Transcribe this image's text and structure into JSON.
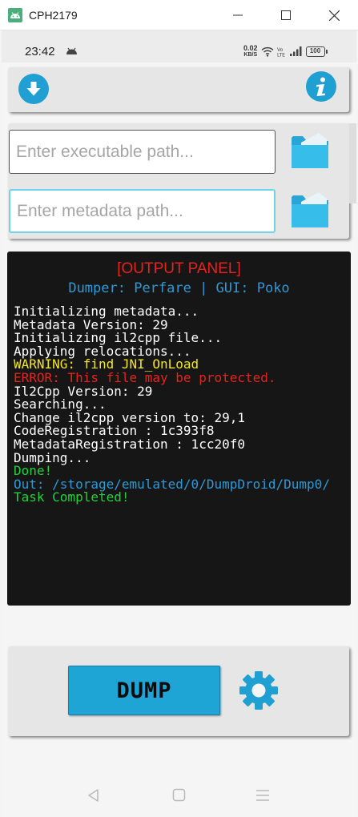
{
  "window": {
    "title": "CPH2179"
  },
  "statusbar": {
    "time": "23:42",
    "net_speed_value": "0.02",
    "net_speed_unit": "KB/S",
    "battery": "100"
  },
  "toolbar": {
    "download_icon": "download-icon",
    "info_icon": "info-icon"
  },
  "inputs": {
    "executable_placeholder": "Enter executable path...",
    "metadata_placeholder": "Enter metadata path...",
    "executable_value": "",
    "metadata_value": ""
  },
  "output": {
    "title": "[OUTPUT PANEL]",
    "subtitle": "Dumper: Perfare | GUI: Poko",
    "lines": [
      {
        "text": "Initializing metadata...",
        "color": "#ffffff"
      },
      {
        "text": "Metadata Version: 29",
        "color": "#ffffff"
      },
      {
        "text": "Initializing il2cpp file...",
        "color": "#ffffff"
      },
      {
        "text": "Applying relocations...",
        "color": "#ffffff"
      },
      {
        "text": "WARNING: find JNI_OnLoad",
        "color": "#f2e527"
      },
      {
        "text": "ERROR: This file may be protected.",
        "color": "#e8231e"
      },
      {
        "text": "Il2Cpp Version: 29",
        "color": "#ffffff"
      },
      {
        "text": "Searching...",
        "color": "#ffffff"
      },
      {
        "text": "Change il2cpp version to: 29,1",
        "color": "#ffffff"
      },
      {
        "text": "CodeRegistration : 1c393f8",
        "color": "#ffffff"
      },
      {
        "text": "MetadataRegistration : 1cc20f0",
        "color": "#ffffff"
      },
      {
        "text": "Dumping...",
        "color": "#ffffff"
      },
      {
        "text": "Done!",
        "color": "#22d23a"
      },
      {
        "text": "Out: /storage/emulated/0/DumpDroid/Dump0/",
        "color": "#2d9ad6"
      },
      {
        "text": "Task Completed!",
        "color": "#22d23a"
      }
    ]
  },
  "actions": {
    "dump_label": "DUMP",
    "settings_icon": "gear-icon"
  },
  "colors": {
    "accent": "#1fa4d6",
    "folder": "#33b9e6",
    "error": "#e8231e",
    "warning": "#f2e527",
    "success": "#22d23a"
  }
}
